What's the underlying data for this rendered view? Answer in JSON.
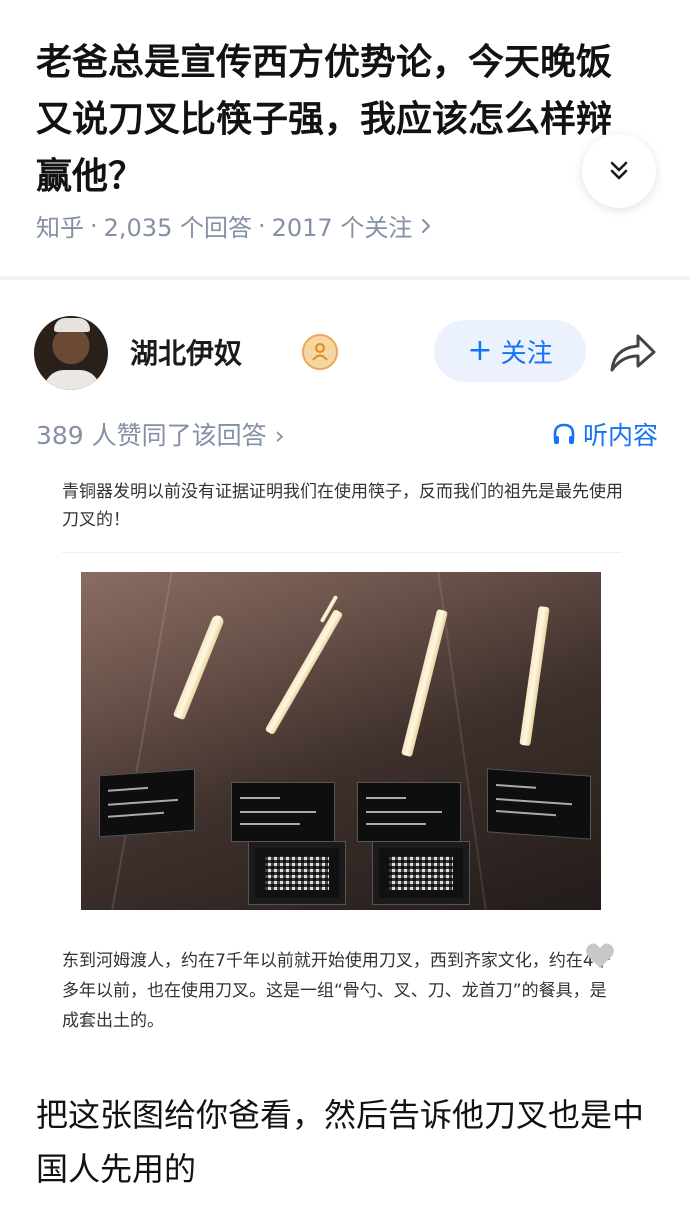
{
  "question": {
    "title": "老爸总是宣传西方优势论，今天晚饭又说刀叉比筷子强，我应该怎么样辩赢他？",
    "source": "知乎",
    "answers": "2,035 个回答",
    "followers": "2017 个关注"
  },
  "author": {
    "name": "湖北伊奴",
    "follow_label": "关注"
  },
  "answer_meta": {
    "votes": "389 人赞同了该回答",
    "listen_label": "听内容"
  },
  "embedded_image": {
    "caption_top": "青铜器发明以前没有证据证明我们在使用筷子，反而我们的祖先是最先使用刀叉的！",
    "caption_bottom": "东到河姆渡人，约在7千年以前就开始使用刀叉，西到齐家文化，约在4千多年以前，也在使用刀叉。这是一组“骨勺、叉、刀、龙首刀”的餐具，是成套出土的。"
  },
  "answer_text": "把这张图给你爸看，然后告诉他刀叉也是中国人先用的",
  "colors": {
    "accent": "#1772f6",
    "meta_gray": "#8590a6",
    "follow_bg": "#ebf2fe"
  },
  "icons": {
    "expand": "double-chevron-down-icon",
    "share": "share-arrow-icon",
    "listen": "headphones-icon",
    "badge": "person-badge-icon"
  }
}
